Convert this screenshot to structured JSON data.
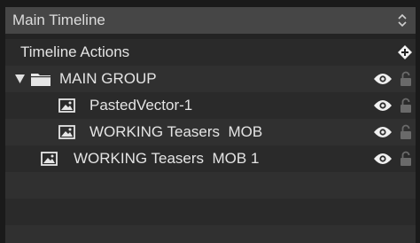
{
  "timeline": {
    "title": "Main Timeline",
    "actions_label": "Timeline Actions"
  },
  "layers": [
    {
      "label": "MAIN GROUP",
      "type": "group",
      "expanded": true,
      "visible": true,
      "locked": false
    },
    {
      "label": "PastedVector-1",
      "type": "image",
      "visible": true,
      "locked": false
    },
    {
      "label": "WORKING Teasers  MOB",
      "type": "image",
      "visible": true,
      "locked": false
    },
    {
      "label": "WORKING Teasers  MOB 1",
      "type": "image",
      "visible": true,
      "locked": false
    }
  ],
  "icons": {
    "header": "chevron-up-down-icon",
    "actions": "add-action-icon",
    "expand": "disclosure-triangle-icon",
    "group": "folder-icon",
    "layer": "image-layer-icon",
    "visibility": "eye-icon",
    "lock": "lock-icon"
  },
  "colors": {
    "panel_bg": "#232323",
    "header_bg": "#464646",
    "text": "#e4e4e4",
    "icon": "#f0f0f0",
    "lock_dim": "#6a6a6a"
  }
}
